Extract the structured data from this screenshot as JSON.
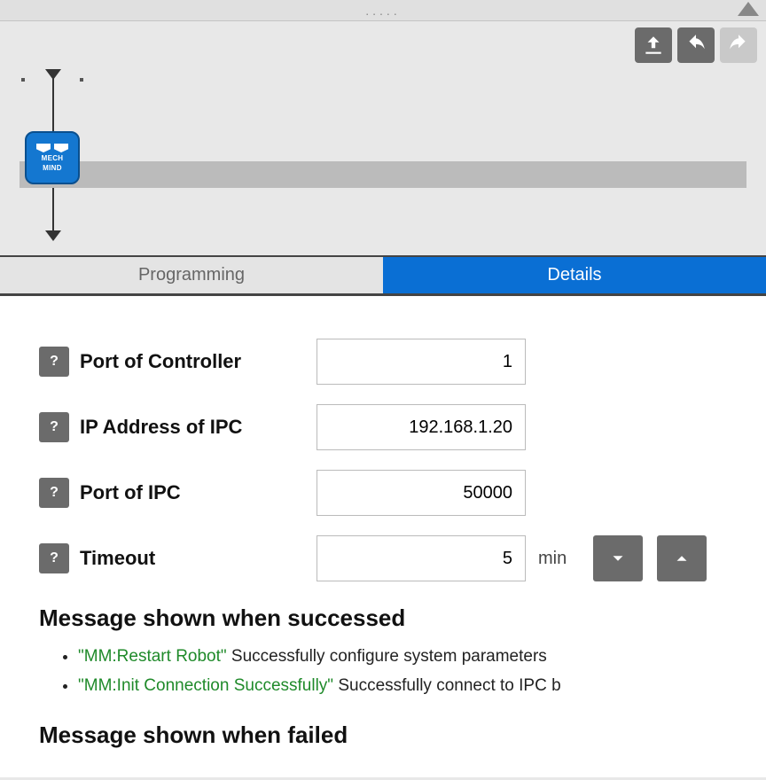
{
  "topbar": {
    "dots": "....."
  },
  "toolbar": {
    "upload_icon": "upload",
    "undo_icon": "undo",
    "redo_icon": "redo"
  },
  "node": {
    "line1": "MECH",
    "line2": "MIND"
  },
  "tabs": {
    "programming": "Programming",
    "details": "Details"
  },
  "form": {
    "port_controller": {
      "label": "Port of Controller",
      "value": "1",
      "help": "?"
    },
    "ip_ipc": {
      "label": "IP Address of IPC",
      "value": "192.168.1.20",
      "help": "?"
    },
    "port_ipc": {
      "label": "Port of IPC",
      "value": "50000",
      "help": "?"
    },
    "timeout": {
      "label": "Timeout",
      "value": "5",
      "unit": "min",
      "help": "?"
    }
  },
  "messages": {
    "success_heading": "Message shown when successed",
    "success_items": [
      {
        "tag": "\"MM:Restart Robot\"",
        "text": " Successfully configure system parameters"
      },
      {
        "tag": "\"MM:Init Connection Successfully\"",
        "text": " Successfully connect to IPC b"
      }
    ],
    "failed_heading": "Message shown when failed"
  }
}
